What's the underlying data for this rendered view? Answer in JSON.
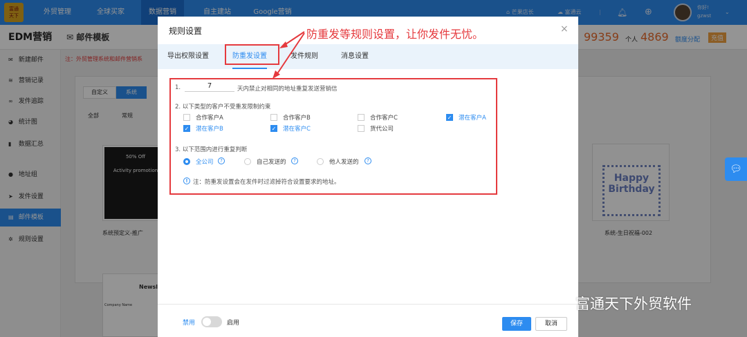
{
  "topnav": {
    "logo": "logo-icon",
    "items": [
      {
        "label": "外贸管理",
        "active": false
      },
      {
        "label": "全球买家",
        "active": false
      },
      {
        "label": "数据营销",
        "active": true
      },
      {
        "label": "自主建站",
        "active": false
      },
      {
        "label": "Google营销",
        "active": false
      }
    ],
    "shop_label": "芒果店长",
    "cloud_label": "富通云",
    "greeting": "你好!",
    "username": "gzwst",
    "icons": [
      "shop-icon",
      "cloud-icon",
      "bell-icon",
      "plus-icon",
      "chevron-down-icon"
    ]
  },
  "subheader": {
    "section_title": "EDM营销",
    "page_title": "邮件模板",
    "quota_enterprise": "99359",
    "personal_label": "个人",
    "quota_personal": "4869",
    "allocate_label": "额度分配",
    "recharge_label": "充值"
  },
  "sidebar": {
    "items": [
      {
        "label": "新建邮件",
        "icon": "mail-icon"
      },
      {
        "label": "营销记录",
        "icon": "layers-icon"
      },
      {
        "label": "发件追踪",
        "icon": "binoculars-icon"
      },
      {
        "label": "统计图",
        "icon": "pie-chart-icon"
      },
      {
        "label": "数据汇总",
        "icon": "bar-chart-icon"
      },
      {
        "label": "地址组",
        "icon": "location-icon"
      },
      {
        "label": "发件设置",
        "icon": "send-icon"
      },
      {
        "label": "邮件模板",
        "icon": "template-icon",
        "active": true
      },
      {
        "label": "规则设置",
        "icon": "gear-icon"
      }
    ]
  },
  "background": {
    "notice": "注：外贸管理系统和邮件营销系",
    "type_tabs": [
      "自定义",
      "系统"
    ],
    "category_tabs": [
      "全部",
      "常规"
    ],
    "card1_label": "系统预定义-推广",
    "card1_promo": "50% Off",
    "card1_sub": "Activity promotion",
    "card2_label": "系统-生日祝福-002",
    "card2_art": "Happy Birthday",
    "card3_title": "Newsle",
    "card3_company": "Company Name"
  },
  "modal": {
    "title": "规则设置",
    "close": "×",
    "tabs": [
      {
        "label": "导出权限设置",
        "active": false
      },
      {
        "label": "防重发设置",
        "active": true
      },
      {
        "label": "发件规则",
        "active": false
      },
      {
        "label": "消息设置",
        "active": false
      }
    ],
    "rule1_num": "1.",
    "days_value": "7",
    "rule1_text": "天内禁止对相同的地址重复发送营销信",
    "rule2_title": "2. 以下类型的客户不受重发限制约束",
    "checkboxes": [
      {
        "label": "合作客户A",
        "checked": false
      },
      {
        "label": "合作客户B",
        "checked": false
      },
      {
        "label": "合作客户C",
        "checked": false
      },
      {
        "label": "潜在客户A",
        "checked": true
      },
      {
        "label": "潜在客户B",
        "checked": true
      },
      {
        "label": "潜在客户C",
        "checked": true
      },
      {
        "label": "货代公司",
        "checked": false
      }
    ],
    "rule3_title": "3. 以下范围内进行重复判断",
    "radios": [
      {
        "label": "全公司",
        "selected": true
      },
      {
        "label": "自己发送的",
        "selected": false
      },
      {
        "label": "他人发送的",
        "selected": false
      }
    ],
    "note": "注：防重发设置会在发件时过滤掉符合设置要求的地址。",
    "toggle_off_label": "禁用",
    "toggle_on_label": "启用",
    "save_label": "保存",
    "cancel_label": "取消"
  },
  "annotation": {
    "text": "防重发等规则设置，让你发件无忧。"
  },
  "watermark": {
    "text": "富通天下外贸软件"
  },
  "colors": {
    "primary": "#2d8cf0",
    "annotation": "#e5393d",
    "quota": "#e86a2a"
  }
}
